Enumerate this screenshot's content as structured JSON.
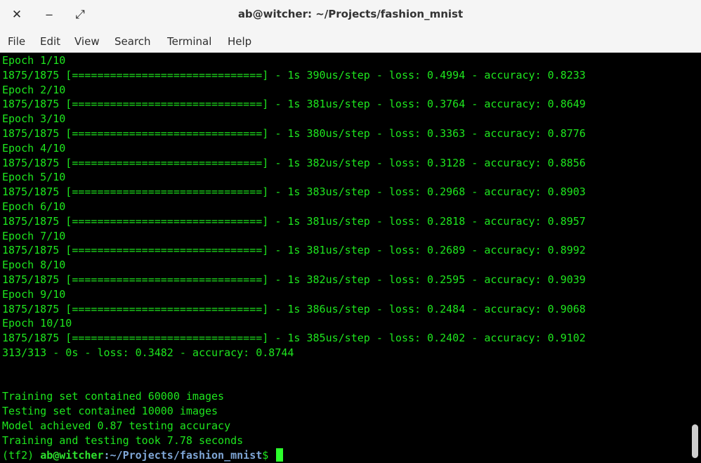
{
  "window": {
    "title": "ab@witcher: ~/Projects/fashion_mnist",
    "close_glyph": "✕",
    "minimize_glyph": "‒",
    "maximize_glyph": "⤢"
  },
  "menu": [
    "File",
    "Edit",
    "View",
    "Search",
    "Terminal",
    "Help"
  ],
  "terminal": {
    "lines": [
      "Epoch 1/10",
      "1875/1875 [==============================] - 1s 390us/step - loss: 0.4994 - accuracy: 0.8233",
      "Epoch 2/10",
      "1875/1875 [==============================] - 1s 381us/step - loss: 0.3764 - accuracy: 0.8649",
      "Epoch 3/10",
      "1875/1875 [==============================] - 1s 380us/step - loss: 0.3363 - accuracy: 0.8776",
      "Epoch 4/10",
      "1875/1875 [==============================] - 1s 382us/step - loss: 0.3128 - accuracy: 0.8856",
      "Epoch 5/10",
      "1875/1875 [==============================] - 1s 383us/step - loss: 0.2968 - accuracy: 0.8903",
      "Epoch 6/10",
      "1875/1875 [==============================] - 1s 381us/step - loss: 0.2818 - accuracy: 0.8957",
      "Epoch 7/10",
      "1875/1875 [==============================] - 1s 381us/step - loss: 0.2689 - accuracy: 0.8992",
      "Epoch 8/10",
      "1875/1875 [==============================] - 1s 382us/step - loss: 0.2595 - accuracy: 0.9039",
      "Epoch 9/10",
      "1875/1875 [==============================] - 1s 386us/step - loss: 0.2484 - accuracy: 0.9068",
      "Epoch 10/10",
      "1875/1875 [==============================] - 1s 385us/step - loss: 0.2402 - accuracy: 0.9102",
      "313/313 - 0s - loss: 0.3482 - accuracy: 0.8744",
      "",
      "",
      "Training set contained 60000 images",
      "Testing set contained 10000 images",
      "Model achieved 0.87 testing accuracy",
      "Training and testing took 7.78 seconds"
    ],
    "prompt": {
      "env": "(tf2) ",
      "user_host": "ab@witcher",
      "separator": ":",
      "path": "~/Projects/fashion_mnist",
      "symbol": "$ "
    }
  },
  "colors": {
    "terminal_bg": "#000000",
    "terminal_fg": "#1ee61e",
    "prompt_path": "#7fa6d6",
    "chrome_bg": "#f5f5f5"
  }
}
